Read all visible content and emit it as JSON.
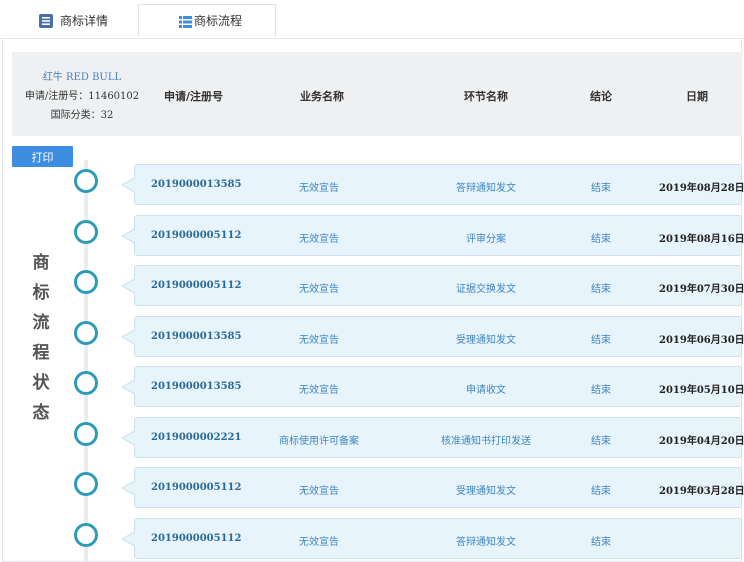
{
  "tabs": [
    {
      "label": "商标详情",
      "icon": "document-list-icon"
    },
    {
      "label": "商标流程",
      "icon": "table-list-icon"
    }
  ],
  "info": {
    "trademark_name": "红牛 RED BULL",
    "reg_number_line": "申请/注册号：11460102",
    "class_line": "国际分类：32"
  },
  "table": {
    "headers": [
      "申请/注册号",
      "业务名称",
      "环节名称",
      "结论",
      "日期"
    ],
    "rows": [
      {
        "no": "2019000013585",
        "business": "无效宣告",
        "step": "答辩通知发文",
        "result": "结束",
        "date": "2019年08月28日"
      },
      {
        "no": "2019000005112",
        "business": "无效宣告",
        "step": "评审分案",
        "result": "结束",
        "date": "2019年08月16日"
      },
      {
        "no": "2019000005112",
        "business": "无效宣告",
        "step": "证据交换发文",
        "result": "结束",
        "date": "2019年07月30日"
      },
      {
        "no": "2019000013585",
        "business": "无效宣告",
        "step": "受理通知发文",
        "result": "结束",
        "date": "2019年06月30日"
      },
      {
        "no": "2019000013585",
        "business": "无效宣告",
        "step": "申请收文",
        "result": "结束",
        "date": "2019年05月10日"
      },
      {
        "no": "2019000002221",
        "business": "商标使用许可备案",
        "step": "核准通知书打印发送",
        "result": "结束",
        "date": "2019年04月20日"
      },
      {
        "no": "2019000005112",
        "business": "无效宣告",
        "step": "受理通知发文",
        "result": "结束",
        "date": "2019年03月28日"
      },
      {
        "no": "2019000005112",
        "business": "无效宣告",
        "step": "答辩通知发文",
        "result": "结束",
        "date": ""
      }
    ]
  },
  "print_button": "打印",
  "vertical_title": [
    "商",
    "标",
    "流",
    "程",
    "状",
    "态"
  ],
  "colors": {
    "accent": "#3d8ee0",
    "node": "#2e9bb8",
    "row_bg": "#e8f4fb"
  }
}
